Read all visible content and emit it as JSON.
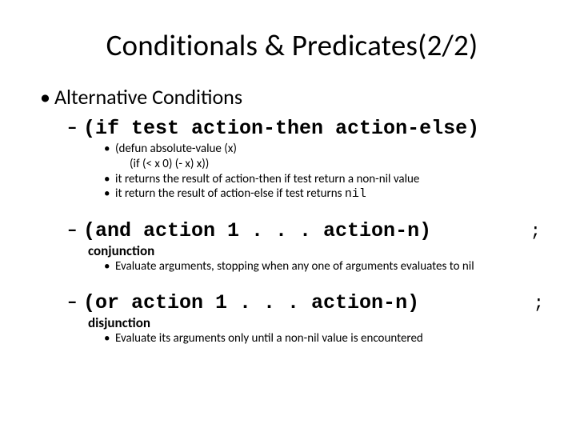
{
  "title": "Conditionals &  Predicates(2/2)",
  "l1": "Alternative Conditions",
  "ifBlock": {
    "head": "(if test action-then action-else)",
    "sub1a": "(defun absolute-value (x)",
    "sub1b": "(if (< x 0) (- x)  x))",
    "sub2": "it returns the result of action-then if test return a non-nil value",
    "sub3a": "it return the result of action-else if test returns ",
    "sub3b": "nil"
  },
  "andBlock": {
    "head": "(and action 1 . . . action-n)",
    "semi": ";",
    "label": "conjunction",
    "sub": "Evaluate arguments, stopping when any one of arguments evaluates to nil"
  },
  "orBlock": {
    "head": "(or action 1 . . . action-n)",
    "semi": ";",
    "label": "disjunction",
    "sub": "Evaluate its arguments only until a non-nil value is encountered"
  }
}
